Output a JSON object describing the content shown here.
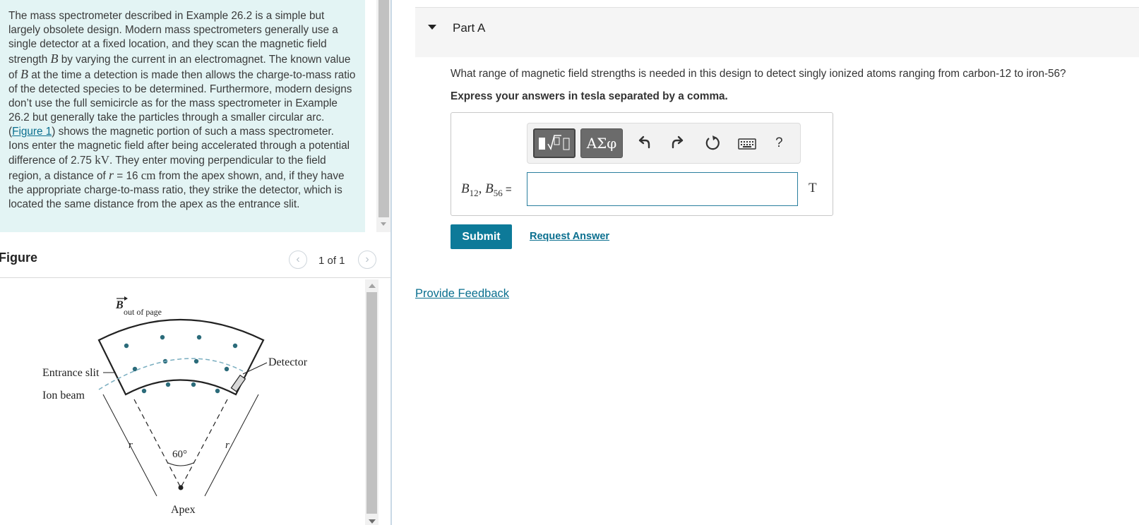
{
  "problem": {
    "t1": "The mass spectrometer described in Example 26.2 is a simple but largely obsolete design. Modern mass spectrometers generally use a single detector at a fixed location, and they scan the magnetic field strength ",
    "b_symbol": "B",
    "t2": " by varying the current in an electromagnet. The known value of ",
    "t3": " at the time a detection is made then allows the charge-to-mass ratio of the detected species to be determined. Furthermore, modern designs don’t use the full semicircle as for the mass spectrometer in Example 26.2 but generally take the particles through a smaller circular arc. (",
    "figure_link": "Figure 1",
    "t4": ") shows the magnetic portion of such a mass spectrometer. Ions enter the magnetic field after being accelerated through a potential difference of 2.75 ",
    "kv_unit": "kV",
    "t5": ". They enter moving perpendicular to the field region, a distance of ",
    "r_symbol": "r",
    "t6": " = 16 ",
    "cm_unit": "cm",
    "t7": " from the apex shown, and, if they have the appropriate charge-to-mass ratio, they strike the detector, which is located the same distance from the apex as the entrance slit."
  },
  "figure": {
    "title": "Figure",
    "counter": "1 of 1",
    "prev_glyph": "‹",
    "next_glyph": "›",
    "labels": {
      "b_symbol": "B",
      "b_subscript": "out of page",
      "entrance": "Entrance slit",
      "ion_beam": "Ion beam",
      "detector": "Detector",
      "angle": "60°",
      "r_left": "r",
      "r_right": "r",
      "apex": "Apex"
    }
  },
  "part": {
    "title": "Part A",
    "question": "What range of magnetic field strengths is needed in this design to detect singly ionized atoms ranging from carbon-12 to iron-56?",
    "instructions": "Express your answers in tesla separated by a comma.",
    "eq_b": "B",
    "eq_sub1": "12",
    "eq_sep": ", ",
    "eq_sub2": "56",
    "eq_equals": " =",
    "answer_value": "",
    "unit": "T",
    "toolbar": {
      "greek_label": "ΑΣφ",
      "help_label": "?",
      "icons": [
        "templates-icon",
        "greek-letters-icon",
        "undo-icon",
        "redo-icon",
        "reset-icon",
        "keyboard-icon",
        "help-icon"
      ]
    },
    "submit_label": "Submit",
    "request_label": "Request Answer"
  },
  "feedback_label": "Provide Feedback",
  "colors": {
    "accent": "#0d7a99",
    "link": "#0a6f8f",
    "problem_bg": "#e3f4f4",
    "figure_dots": "#2b6b7a"
  }
}
